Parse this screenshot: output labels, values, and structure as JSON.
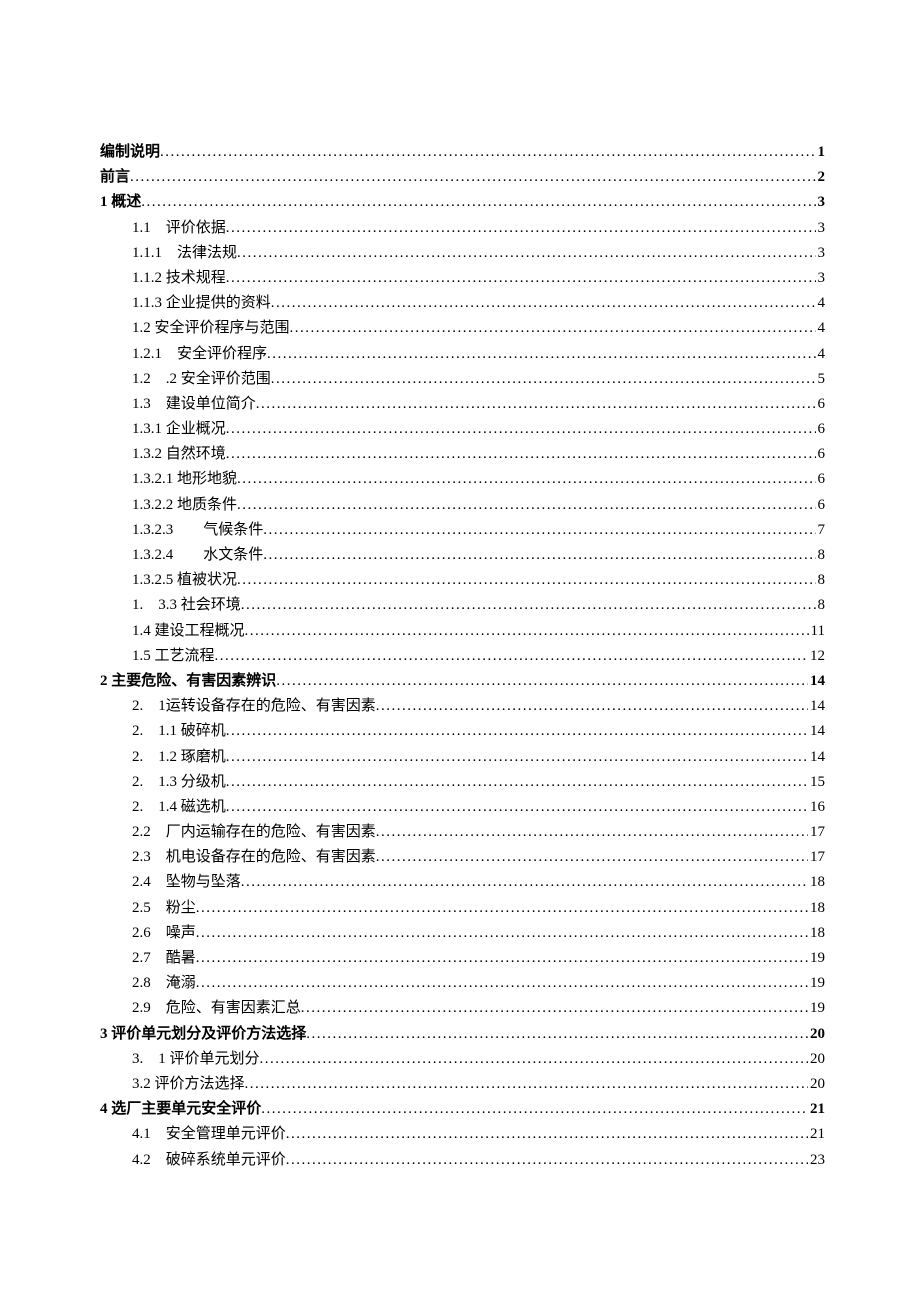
{
  "toc": [
    {
      "label": "编制说明",
      "page": "1",
      "indent": 0,
      "bold": true
    },
    {
      "label": "前言",
      "page": "2",
      "indent": 0,
      "bold": true
    },
    {
      "label": "1 概述",
      "page": "3",
      "indent": 0,
      "bold": true
    },
    {
      "label": "1.1　评价依据",
      "page": "3",
      "indent": 1,
      "bold": false
    },
    {
      "label": "1.1.1　法律法规",
      "page": "3",
      "indent": 1,
      "bold": false
    },
    {
      "label": "1.1.2 技术规程",
      "page": "3",
      "indent": 1,
      "bold": false
    },
    {
      "label": "1.1.3 企业提供的资料",
      "page": "4",
      "indent": 1,
      "bold": false
    },
    {
      "label": "1.2 安全评价程序与范围",
      "page": "4",
      "indent": 1,
      "bold": false
    },
    {
      "label": "1.2.1　安全评价程序",
      "page": "4",
      "indent": 1,
      "bold": false
    },
    {
      "label": "1.2　.2 安全评价范围",
      "page": "5",
      "indent": 1,
      "bold": false
    },
    {
      "label": "1.3　建设单位简介",
      "page": "6",
      "indent": 1,
      "bold": false
    },
    {
      "label": "1.3.1 企业概况",
      "page": "6",
      "indent": 1,
      "bold": false
    },
    {
      "label": "1.3.2 自然环境",
      "page": "6",
      "indent": 1,
      "bold": false
    },
    {
      "label": "1.3.2.1 地形地貌",
      "page": "6",
      "indent": 1,
      "bold": false
    },
    {
      "label": "1.3.2.2 地质条件",
      "page": "6",
      "indent": 1,
      "bold": false
    },
    {
      "label": "1.3.2.3　　气候条件",
      "page": "7",
      "indent": 1,
      "bold": false
    },
    {
      "label": "1.3.2.4　　水文条件",
      "page": "8",
      "indent": 1,
      "bold": false
    },
    {
      "label": "1.3.2.5 植被状况",
      "page": "8",
      "indent": 1,
      "bold": false
    },
    {
      "label": "1.　3.3 社会环境",
      "page": "8",
      "indent": 1,
      "bold": false
    },
    {
      "label": "1.4 建设工程概况",
      "page": "11",
      "indent": 1,
      "bold": false
    },
    {
      "label": "1.5 工艺流程",
      "page": "12",
      "indent": 1,
      "bold": false
    },
    {
      "label": "2 主要危险、有害因素辨识",
      "page": "14",
      "indent": 0,
      "bold": true
    },
    {
      "label": "2.　1运转设备存在的危险、有害因素",
      "page": "14",
      "indent": 1,
      "bold": false
    },
    {
      "label": "2.　1.1 破碎机",
      "page": "14",
      "indent": 1,
      "bold": false
    },
    {
      "label": "2.　1.2 琢磨机",
      "page": "14",
      "indent": 1,
      "bold": false
    },
    {
      "label": "2.　1.3 分级机",
      "page": "15",
      "indent": 1,
      "bold": false
    },
    {
      "label": "2.　1.4 磁选机",
      "page": "16",
      "indent": 1,
      "bold": false
    },
    {
      "label": "2.2　厂内运输存在的危险、有害因素",
      "page": "17",
      "indent": 1,
      "bold": false
    },
    {
      "label": "2.3　机电设备存在的危险、有害因素",
      "page": "17",
      "indent": 1,
      "bold": false
    },
    {
      "label": "2.4　坠物与坠落",
      "page": "18",
      "indent": 1,
      "bold": false
    },
    {
      "label": "2.5　粉尘",
      "page": "18",
      "indent": 1,
      "bold": false
    },
    {
      "label": "2.6　噪声",
      "page": "18",
      "indent": 1,
      "bold": false
    },
    {
      "label": "2.7　酷暑",
      "page": "19",
      "indent": 1,
      "bold": false
    },
    {
      "label": "2.8　淹溺",
      "page": "19",
      "indent": 1,
      "bold": false
    },
    {
      "label": "2.9　危险、有害因素汇总",
      "page": "19",
      "indent": 1,
      "bold": false
    },
    {
      "label": "3 评价单元划分及评价方法选择",
      "page": "20",
      "indent": 0,
      "bold": true
    },
    {
      "label": "3.　1 评价单元划分",
      "page": "20",
      "indent": 1,
      "bold": false
    },
    {
      "label": "3.2 评价方法选择",
      "page": "20",
      "indent": 1,
      "bold": false
    },
    {
      "label": "4 选厂主要单元安全评价",
      "page": "21",
      "indent": 0,
      "bold": true
    },
    {
      "label": "4.1　安全管理单元评价",
      "page": "21",
      "indent": 1,
      "bold": false
    },
    {
      "label": "4.2　破碎系统单元评价",
      "page": "23",
      "indent": 1,
      "bold": false
    }
  ]
}
